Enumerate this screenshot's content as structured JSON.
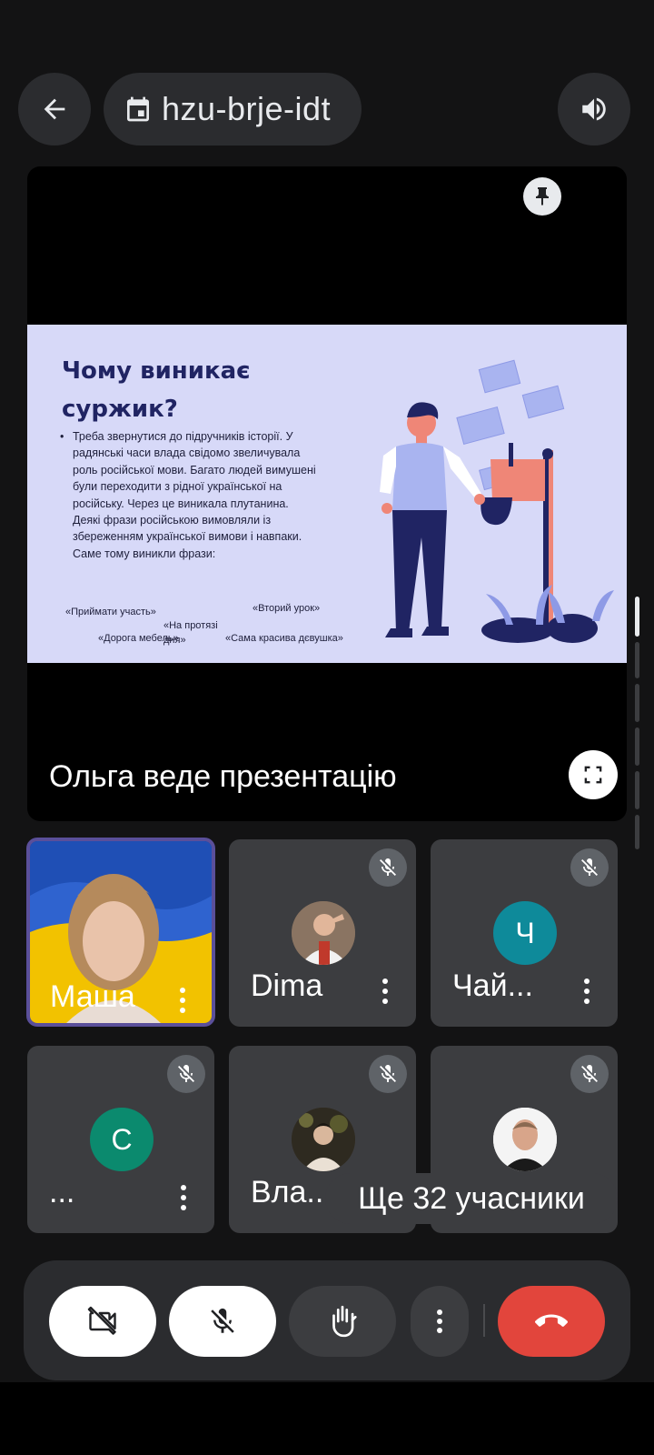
{
  "header": {
    "back_icon": "arrow-left-icon",
    "calendar_icon": "calendar-icon",
    "meeting_code": "hzu-brje-idt",
    "speaker_icon": "speaker-icon"
  },
  "presentation": {
    "pin_icon": "pin-icon",
    "slide": {
      "title": "Чому виникає суржик?",
      "bullet_text": "Треба звернутися до підручників історії. У радянські  часи влада свідомо звеличувала роль російської мови. Багато людей вимушені  були переходити з рідної української на російську. Через це виникала плутанина. Деякі  фрази російською вимовляли  із збереженням української вимови  і  навпаки. Саме тому виникли фрази:",
      "phrases": [
        "«Приймати участь»",
        "«На протязі дня»",
        "«Вторий урок»",
        "«Дорога мебель»",
        "«Сама красива дєвушка»"
      ]
    },
    "caption": "Ольга веде презентацію",
    "fullscreen_icon": "fullscreen-icon"
  },
  "participants": [
    {
      "name": "Маша",
      "type": "video",
      "muted": false
    },
    {
      "name": "Dima",
      "type": "photo",
      "muted": true
    },
    {
      "name": "Чай...",
      "type": "initial",
      "initial": "Ч",
      "color": "#0e8a9a",
      "muted": true
    },
    {
      "name": "...",
      "type": "initial",
      "initial": "С",
      "color": "#0b8a6e",
      "muted": true
    },
    {
      "name": "Вла...",
      "type": "photo",
      "muted": true
    },
    {
      "name": "",
      "type": "photo",
      "muted": true
    }
  ],
  "more_participants": "Ще 32 учасники",
  "controls": {
    "camera": "camera-off-icon",
    "mic": "mic-off-icon",
    "hand": "hand-raise-icon",
    "more": "more-vert-icon",
    "hangup": "call-end-icon",
    "hangup_color": "#e2453c"
  }
}
